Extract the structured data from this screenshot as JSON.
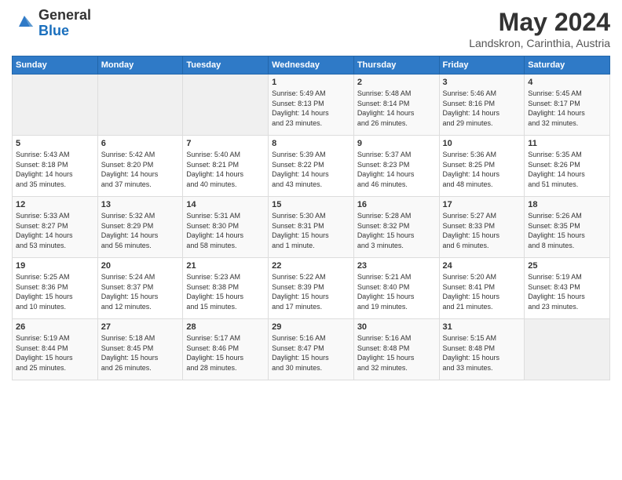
{
  "header": {
    "logo_general": "General",
    "logo_blue": "Blue",
    "month_title": "May 2024",
    "location": "Landskron, Carinthia, Austria"
  },
  "days_of_week": [
    "Sunday",
    "Monday",
    "Tuesday",
    "Wednesday",
    "Thursday",
    "Friday",
    "Saturday"
  ],
  "weeks": [
    [
      {
        "day": "",
        "info": ""
      },
      {
        "day": "",
        "info": ""
      },
      {
        "day": "",
        "info": ""
      },
      {
        "day": "1",
        "info": "Sunrise: 5:49 AM\nSunset: 8:13 PM\nDaylight: 14 hours\nand 23 minutes."
      },
      {
        "day": "2",
        "info": "Sunrise: 5:48 AM\nSunset: 8:14 PM\nDaylight: 14 hours\nand 26 minutes."
      },
      {
        "day": "3",
        "info": "Sunrise: 5:46 AM\nSunset: 8:16 PM\nDaylight: 14 hours\nand 29 minutes."
      },
      {
        "day": "4",
        "info": "Sunrise: 5:45 AM\nSunset: 8:17 PM\nDaylight: 14 hours\nand 32 minutes."
      }
    ],
    [
      {
        "day": "5",
        "info": "Sunrise: 5:43 AM\nSunset: 8:18 PM\nDaylight: 14 hours\nand 35 minutes."
      },
      {
        "day": "6",
        "info": "Sunrise: 5:42 AM\nSunset: 8:20 PM\nDaylight: 14 hours\nand 37 minutes."
      },
      {
        "day": "7",
        "info": "Sunrise: 5:40 AM\nSunset: 8:21 PM\nDaylight: 14 hours\nand 40 minutes."
      },
      {
        "day": "8",
        "info": "Sunrise: 5:39 AM\nSunset: 8:22 PM\nDaylight: 14 hours\nand 43 minutes."
      },
      {
        "day": "9",
        "info": "Sunrise: 5:37 AM\nSunset: 8:23 PM\nDaylight: 14 hours\nand 46 minutes."
      },
      {
        "day": "10",
        "info": "Sunrise: 5:36 AM\nSunset: 8:25 PM\nDaylight: 14 hours\nand 48 minutes."
      },
      {
        "day": "11",
        "info": "Sunrise: 5:35 AM\nSunset: 8:26 PM\nDaylight: 14 hours\nand 51 minutes."
      }
    ],
    [
      {
        "day": "12",
        "info": "Sunrise: 5:33 AM\nSunset: 8:27 PM\nDaylight: 14 hours\nand 53 minutes."
      },
      {
        "day": "13",
        "info": "Sunrise: 5:32 AM\nSunset: 8:29 PM\nDaylight: 14 hours\nand 56 minutes."
      },
      {
        "day": "14",
        "info": "Sunrise: 5:31 AM\nSunset: 8:30 PM\nDaylight: 14 hours\nand 58 minutes."
      },
      {
        "day": "15",
        "info": "Sunrise: 5:30 AM\nSunset: 8:31 PM\nDaylight: 15 hours\nand 1 minute."
      },
      {
        "day": "16",
        "info": "Sunrise: 5:28 AM\nSunset: 8:32 PM\nDaylight: 15 hours\nand 3 minutes."
      },
      {
        "day": "17",
        "info": "Sunrise: 5:27 AM\nSunset: 8:33 PM\nDaylight: 15 hours\nand 6 minutes."
      },
      {
        "day": "18",
        "info": "Sunrise: 5:26 AM\nSunset: 8:35 PM\nDaylight: 15 hours\nand 8 minutes."
      }
    ],
    [
      {
        "day": "19",
        "info": "Sunrise: 5:25 AM\nSunset: 8:36 PM\nDaylight: 15 hours\nand 10 minutes."
      },
      {
        "day": "20",
        "info": "Sunrise: 5:24 AM\nSunset: 8:37 PM\nDaylight: 15 hours\nand 12 minutes."
      },
      {
        "day": "21",
        "info": "Sunrise: 5:23 AM\nSunset: 8:38 PM\nDaylight: 15 hours\nand 15 minutes."
      },
      {
        "day": "22",
        "info": "Sunrise: 5:22 AM\nSunset: 8:39 PM\nDaylight: 15 hours\nand 17 minutes."
      },
      {
        "day": "23",
        "info": "Sunrise: 5:21 AM\nSunset: 8:40 PM\nDaylight: 15 hours\nand 19 minutes."
      },
      {
        "day": "24",
        "info": "Sunrise: 5:20 AM\nSunset: 8:41 PM\nDaylight: 15 hours\nand 21 minutes."
      },
      {
        "day": "25",
        "info": "Sunrise: 5:19 AM\nSunset: 8:43 PM\nDaylight: 15 hours\nand 23 minutes."
      }
    ],
    [
      {
        "day": "26",
        "info": "Sunrise: 5:19 AM\nSunset: 8:44 PM\nDaylight: 15 hours\nand 25 minutes."
      },
      {
        "day": "27",
        "info": "Sunrise: 5:18 AM\nSunset: 8:45 PM\nDaylight: 15 hours\nand 26 minutes."
      },
      {
        "day": "28",
        "info": "Sunrise: 5:17 AM\nSunset: 8:46 PM\nDaylight: 15 hours\nand 28 minutes."
      },
      {
        "day": "29",
        "info": "Sunrise: 5:16 AM\nSunset: 8:47 PM\nDaylight: 15 hours\nand 30 minutes."
      },
      {
        "day": "30",
        "info": "Sunrise: 5:16 AM\nSunset: 8:48 PM\nDaylight: 15 hours\nand 32 minutes."
      },
      {
        "day": "31",
        "info": "Sunrise: 5:15 AM\nSunset: 8:48 PM\nDaylight: 15 hours\nand 33 minutes."
      },
      {
        "day": "",
        "info": ""
      }
    ]
  ]
}
